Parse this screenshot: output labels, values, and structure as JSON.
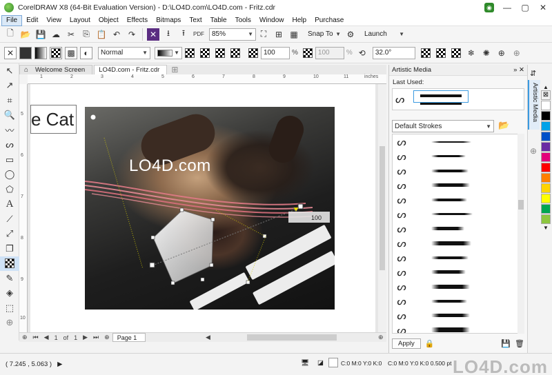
{
  "window": {
    "title": "CorelDRAW X8 (64-Bit Evaluation Version) - D:\\LO4D.com\\LO4D.com - Fritz.cdr",
    "minimize": "—",
    "maximize": "▢",
    "close": "✕"
  },
  "menu": [
    "File",
    "Edit",
    "View",
    "Layout",
    "Object",
    "Effects",
    "Bitmaps",
    "Text",
    "Table",
    "Tools",
    "Window",
    "Help",
    "Purchase"
  ],
  "standard_toolbar": {
    "zoom": "85%",
    "snap_to": "Snap To",
    "launch": "Launch"
  },
  "property_bar": {
    "merge_mode": "Normal",
    "midpoint": "100",
    "midpoint_unit": "%",
    "node_transparency": "100",
    "node_unit": "%",
    "angle": "32.0",
    "angle_unit": "°"
  },
  "doc_tabs": [
    {
      "label": "Welcome Screen",
      "icon": "home-icon"
    },
    {
      "label": "LO4D.com - Fritz.cdr"
    }
  ],
  "ruler": {
    "unit": "inches",
    "h_ticks": [
      "1",
      "2",
      "3",
      "4",
      "5",
      "6",
      "7",
      "8",
      "9",
      "10",
      "11"
    ],
    "v_ticks": [
      "5",
      "6",
      "7",
      "8",
      "9",
      "10"
    ]
  },
  "canvas": {
    "text_frame": "e Cat",
    "photo_text": "LO4D.com",
    "node_value": "100"
  },
  "page_nav": {
    "current": "1",
    "of": "of",
    "total": "1",
    "page_tab": "Page 1"
  },
  "docker": {
    "title": "Artistic Media",
    "last_used_label": "Last Used:",
    "category": "Default Strokes",
    "apply": "Apply",
    "side_tab_label": "Artistic Media",
    "stroke_count": 14
  },
  "palette": {
    "colors": [
      "#ffffff",
      "#000000",
      "#00a2e8",
      "#0050c8",
      "#6a2ba3",
      "#e3007a",
      "#ff0000",
      "#ff7f00",
      "#ffd400",
      "#ffff00",
      "#00a651",
      "#8dc63f"
    ]
  },
  "status": {
    "coords": "( 7.245 , 5.063 )",
    "fill_readout": "C:0 M:0 Y:0 K:0",
    "outline_readout": "C:0 M:0 Y:0 K:0  0.500 pt",
    "watermark": "LO4D.com"
  }
}
